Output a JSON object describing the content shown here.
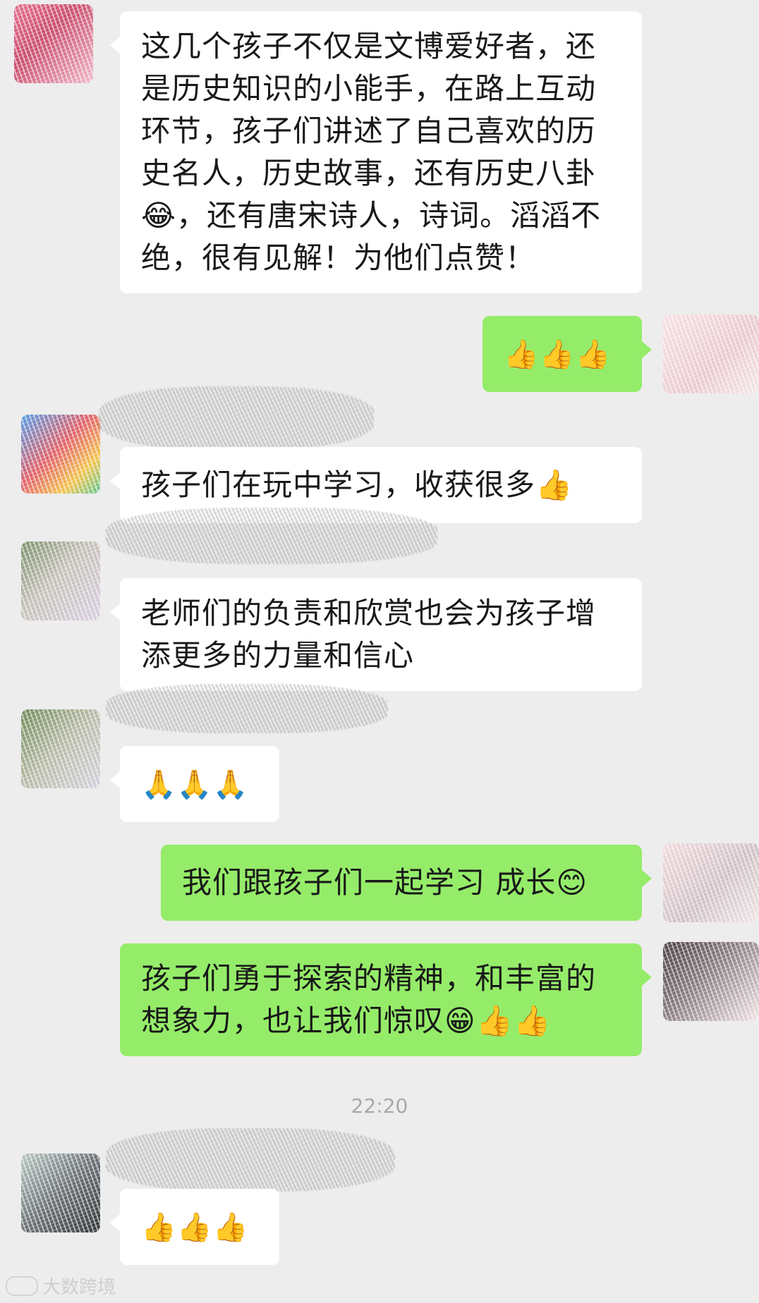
{
  "colors": {
    "background": "#ededed",
    "incoming_bubble": "#ffffff",
    "outgoing_bubble": "#95ec69",
    "timestamp": "#a8a8a8"
  },
  "messages": [
    {
      "id": "m1",
      "direction": "incoming",
      "text": "这几个孩子不仅是文博爱好者，还是历史知识的小能手，在路上互动环节，孩子们讲述了自己喜欢的历史名人，历史故事，还有历史八卦😂，还有唐宋诗人，诗词。滔滔不绝，很有见解！为他们点赞！"
    },
    {
      "id": "m2",
      "direction": "outgoing",
      "text": "👍👍👍"
    },
    {
      "id": "m3",
      "direction": "incoming",
      "text": "孩子们在玩中学习，收获很多👍"
    },
    {
      "id": "m4",
      "direction": "incoming",
      "text": "老师们的负责和欣赏也会为孩子增添更多的力量和信心"
    },
    {
      "id": "m5",
      "direction": "incoming",
      "text": "🙏🙏🙏"
    },
    {
      "id": "m6",
      "direction": "outgoing",
      "text": "我们跟孩子们一起学习 成长😊"
    },
    {
      "id": "m7",
      "direction": "outgoing",
      "text": "孩子们勇于探索的精神，和丰富的想象力，也让我们惊叹😁👍👍"
    },
    {
      "id": "m8",
      "direction": "incoming",
      "text": "👍👍👍"
    }
  ],
  "timestamp": "22:20",
  "watermark": "大数跨境"
}
